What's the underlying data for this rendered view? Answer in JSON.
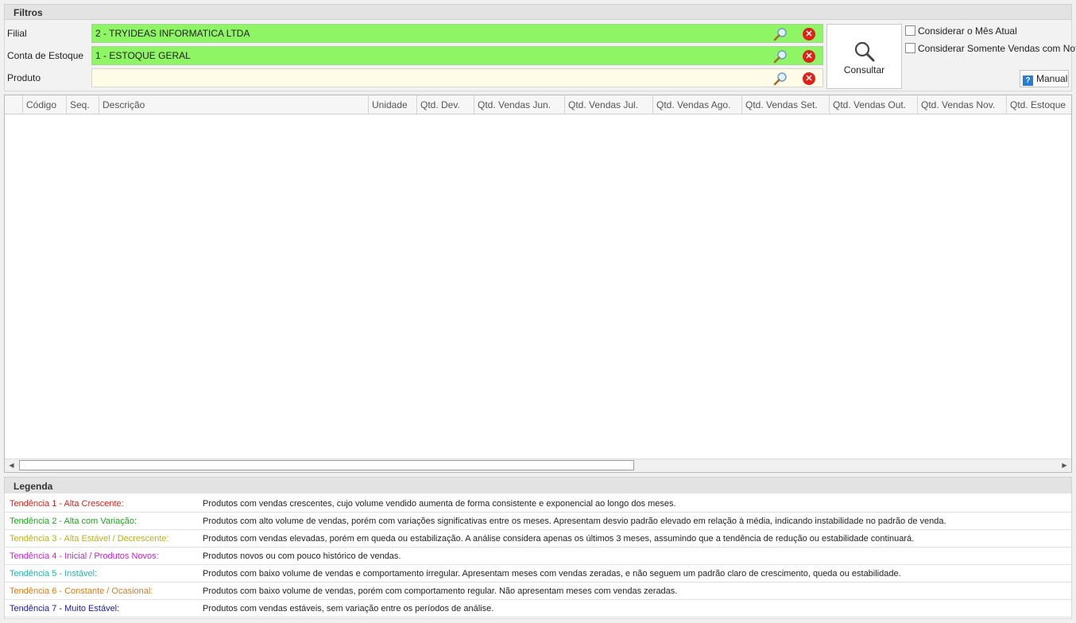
{
  "filters": {
    "title": "Filtros",
    "filial": {
      "label": "Filial",
      "value": "2 - TRYIDEAS INFORMATICA LTDA"
    },
    "conta_estoque": {
      "label": "Conta de Estoque",
      "value": "1 - ESTOQUE GERAL"
    },
    "produto": {
      "label": "Produto",
      "value": ""
    },
    "consult_label": "Consultar",
    "check_mes_atual": "Considerar o Mês Atual",
    "check_vendas_nota": "Considerar Somente Vendas com Nota",
    "manual_label": "Manual"
  },
  "grid": {
    "columns": [
      "Código",
      "Seq.",
      "Descrição",
      "Unidade",
      "Qtd. Dev.",
      "Qtd. Vendas Jun.",
      "Qtd. Vendas Jul.",
      "Qtd. Vendas Ago.",
      "Qtd. Vendas Set.",
      "Qtd. Vendas Out.",
      "Qtd. Vendas Nov.",
      "Qtd. Estoque"
    ]
  },
  "legend": {
    "title": "Legenda",
    "items": [
      {
        "title": "Tendência 1 - Alta Crescente:",
        "color": "#e0201b",
        "desc": "Produtos com vendas crescentes, cujo volume vendido aumenta de forma consistente e exponencial ao longo dos meses."
      },
      {
        "title": "Tendência 2 - Alta com Variação:",
        "color": "#1aa81a",
        "desc": "Produtos com alto volume de vendas, porém com variações significativas entre os meses. Apresentam desvio padrão elevado em relação à média, indicando instabilidade no padrão de venda."
      },
      {
        "title": "Tendência 3 - Alta Estável / Decrescente:",
        "color": "#b9b21a",
        "desc": "Produtos com vendas elevadas, porém em queda ou estabilização. A análise considera apenas os últimos 3 meses, assumindo que a tendência de redução ou estabilidade continuará."
      },
      {
        "title": "Tendência 4 - Inicial / Produtos Novos:",
        "color": "#d01fd0",
        "desc": "Produtos novos ou com pouco histórico de vendas."
      },
      {
        "title": "Tendência 5 - Instável:",
        "color": "#1ab5b5",
        "desc": "Produtos com baixo volume de vendas e comportamento irregular. Apresentam meses com vendas zeradas, e não seguem um padrão claro de crescimento, queda ou estabilidade."
      },
      {
        "title": "Tendência 6 - Constante / Ocasional:",
        "color": "#e07a12",
        "desc": "Produtos com baixo volume de vendas, porém com comportamento regular. Não apresentam meses com vendas zeradas."
      },
      {
        "title": "Tendência 7 - Muito Estável:",
        "color": "#1a1aa8",
        "desc": "Produtos com vendas estáveis, sem variação entre os períodos de análise."
      }
    ]
  }
}
